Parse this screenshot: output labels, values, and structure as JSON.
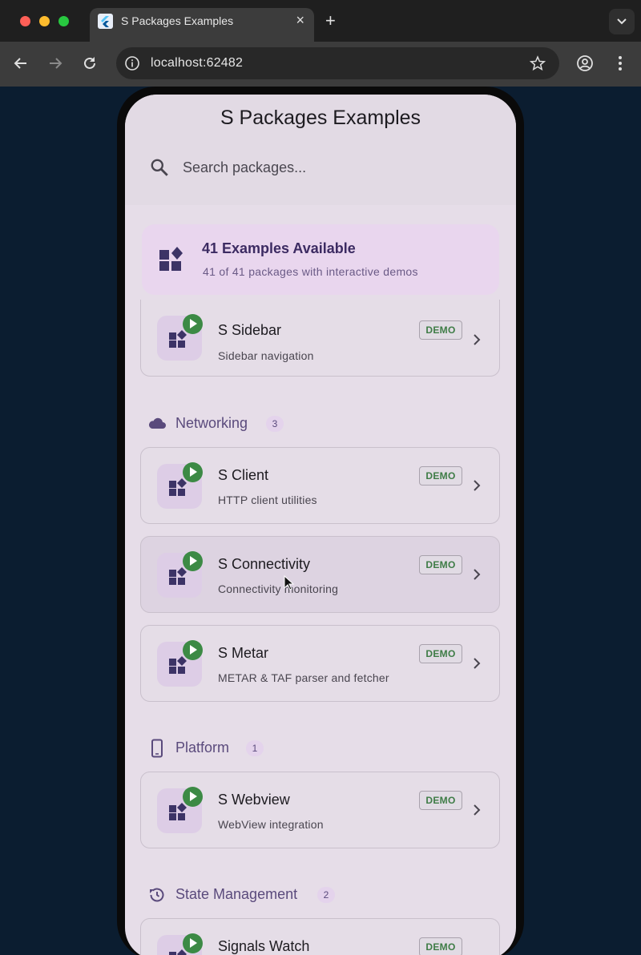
{
  "browser": {
    "tab_title": "S Packages Examples",
    "tab_close": "×",
    "new_tab": "+",
    "url": "localhost:62482"
  },
  "app": {
    "title": "S Packages Examples",
    "search_placeholder": "Search packages...",
    "banner": {
      "title": "41 Examples Available",
      "subtitle": "41 of 41 packages with interactive demos"
    },
    "demo_label": "DEMO",
    "sections": [
      {
        "label": "Networking",
        "count": "3",
        "icon": "cloud-icon"
      },
      {
        "label": "Platform",
        "count": "1",
        "icon": "phone-icon"
      },
      {
        "label": "State Management",
        "count": "2",
        "icon": "history-icon"
      }
    ],
    "cards": [
      {
        "title": "S Sidebar",
        "subtitle": "Sidebar navigation"
      },
      {
        "title": "S Client",
        "subtitle": "HTTP client utilities"
      },
      {
        "title": "S Connectivity",
        "subtitle": "Connectivity monitoring"
      },
      {
        "title": "S Metar",
        "subtitle": "METAR & TAF parser and fetcher"
      },
      {
        "title": "S Webview",
        "subtitle": "WebView integration"
      },
      {
        "title": "Signals Watch",
        "subtitle": ""
      }
    ]
  },
  "colors": {
    "accent": "#5a4a7c",
    "demo_green": "#3e7c46",
    "play_green": "#3c8a45",
    "page_background": "#0b1d30"
  }
}
